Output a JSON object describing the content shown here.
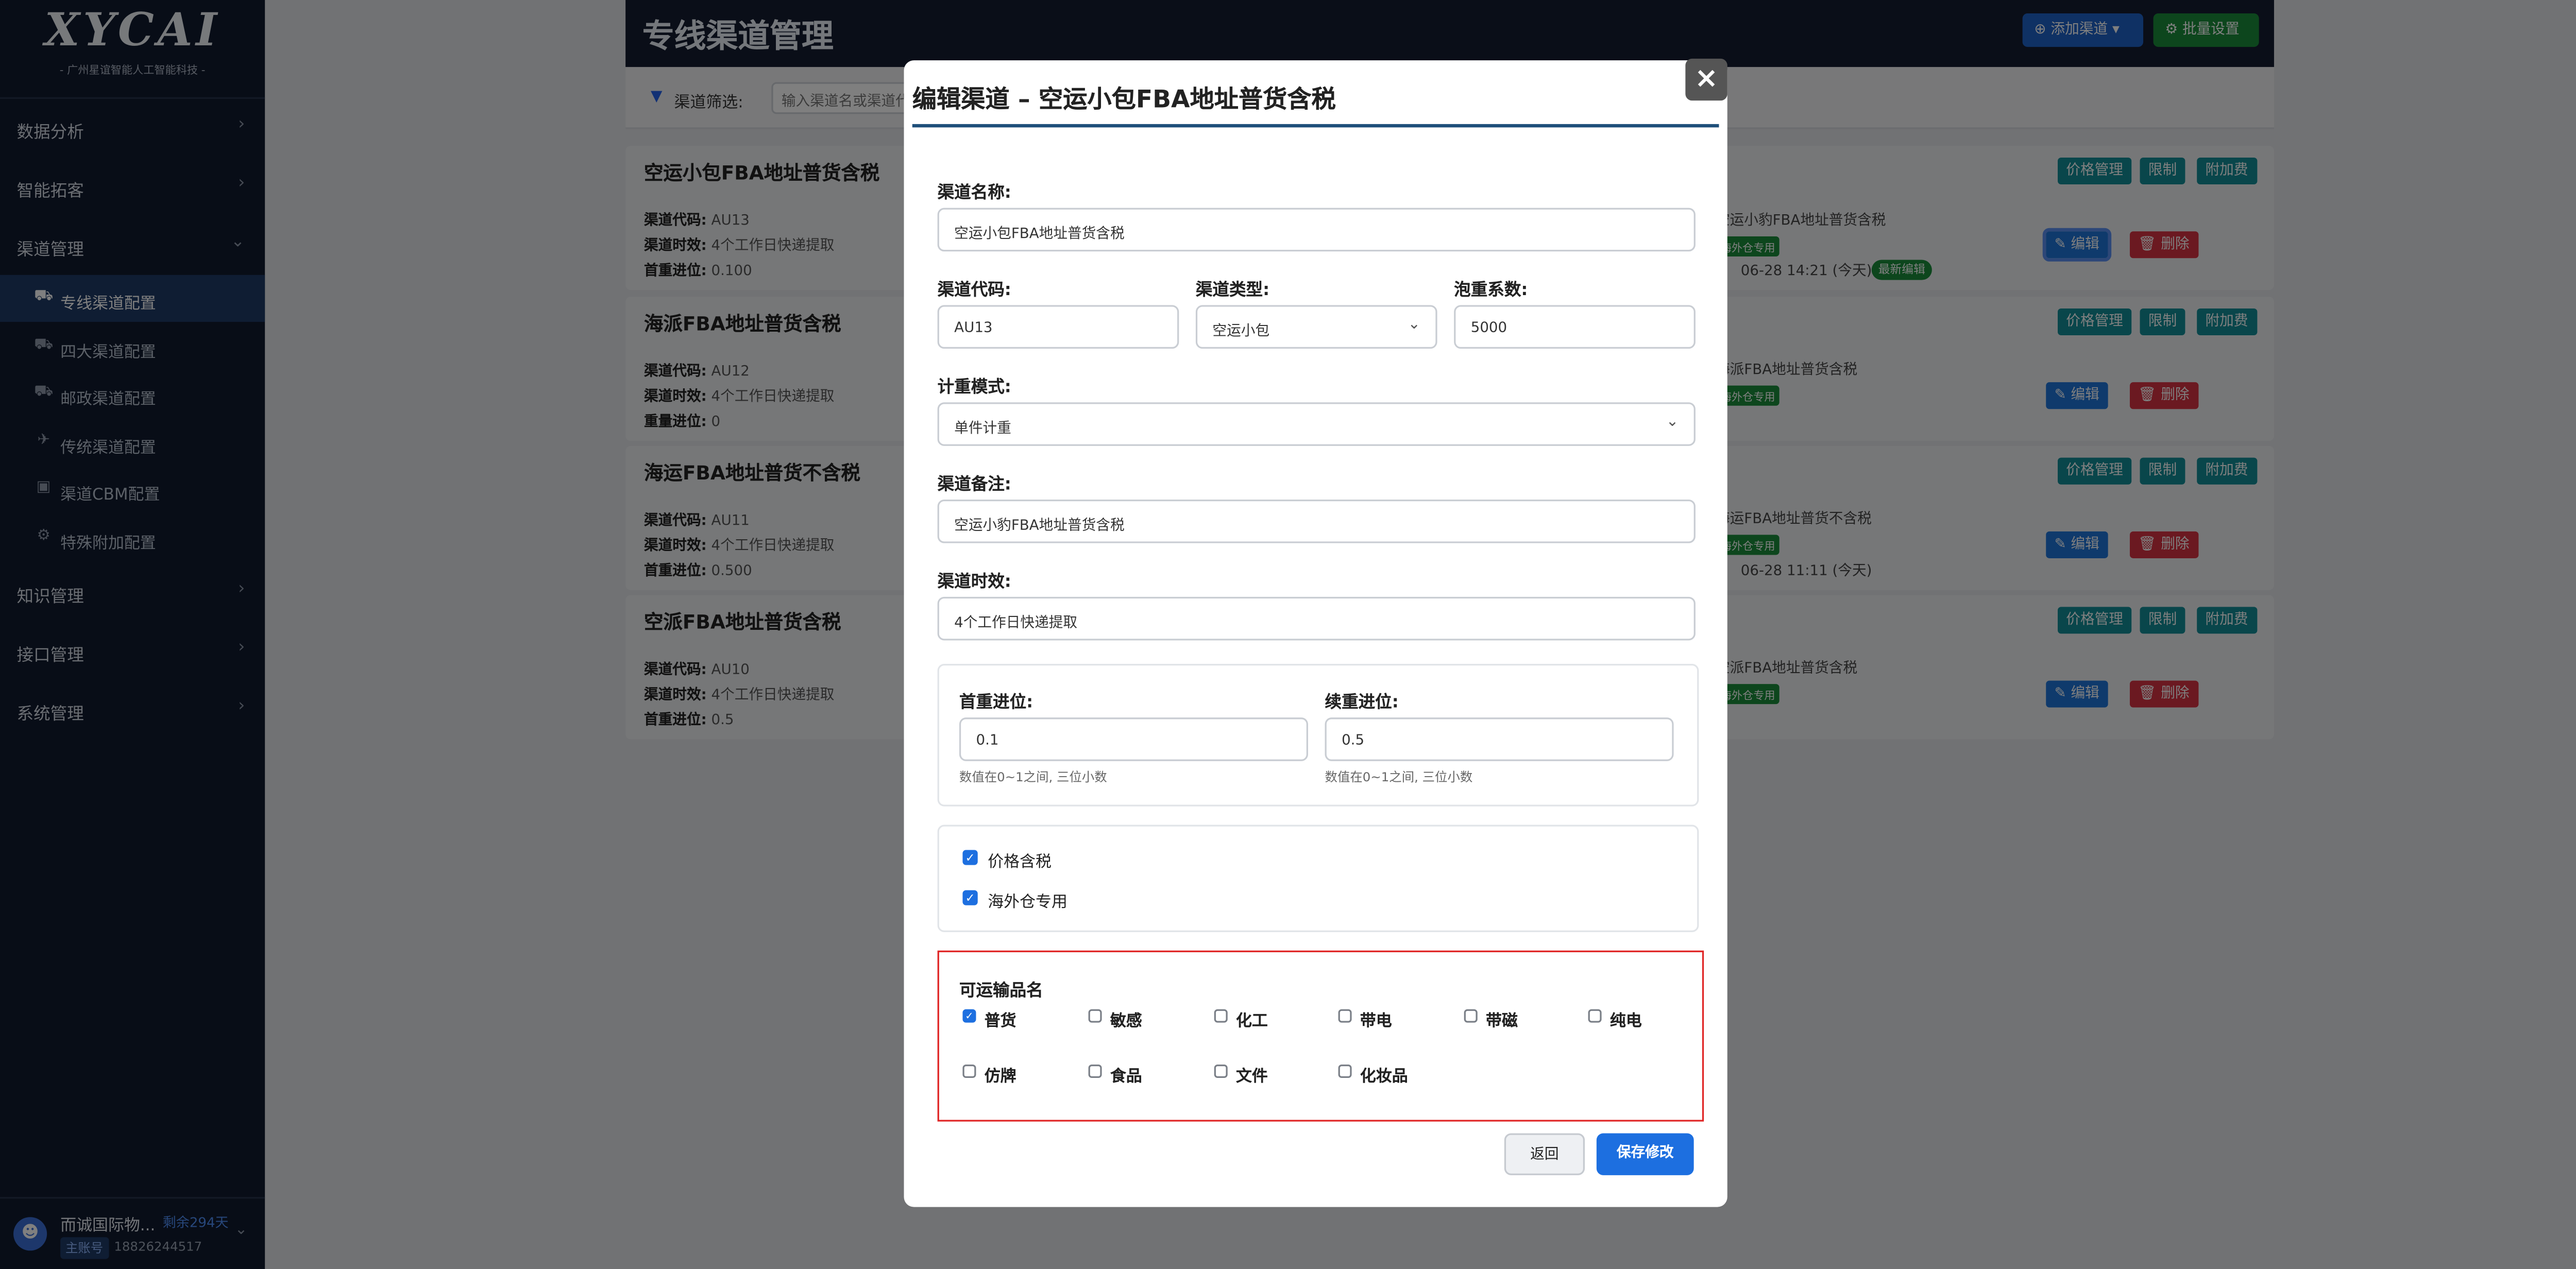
{
  "sidebar": {
    "logo": "XYCAI",
    "logo_sub": "- 广州星谊智能人工智能科技 -",
    "nav": [
      {
        "label": "数据分析",
        "chev": "›"
      },
      {
        "label": "智能拓客",
        "chev": "›"
      },
      {
        "label": "渠道管理",
        "chev": "⌄"
      },
      {
        "label": "知识管理",
        "chev": "›"
      },
      {
        "label": "接口管理",
        "chev": "›"
      },
      {
        "label": "系统管理",
        "chev": "›"
      }
    ],
    "sub": [
      {
        "label": "专线渠道配置",
        "icon": "truck-icon",
        "glyph": "⛟"
      },
      {
        "label": "四大渠道配置",
        "icon": "truck-icon",
        "glyph": "⛟"
      },
      {
        "label": "邮政渠道配置",
        "icon": "truck-icon",
        "glyph": "⛟"
      },
      {
        "label": "传统渠道配置",
        "icon": "plane-icon",
        "glyph": "✈"
      },
      {
        "label": "渠道CBM配置",
        "icon": "box-icon",
        "glyph": "▣"
      },
      {
        "label": "特殊附加配置",
        "icon": "gear-icon",
        "glyph": "⚙"
      }
    ],
    "user": {
      "name": "而诚国际物...",
      "remain": "剩余294天",
      "role": "主账号",
      "phone": "18826244517"
    }
  },
  "header": {
    "title": "专线渠道管理",
    "add_label": "添加渠道",
    "batch_label": "批量设置"
  },
  "filter": {
    "label": "渠道筛选:",
    "placeholder": "输入渠道名或渠道代码"
  },
  "cards": [
    {
      "title": "空运小包FBA地址普货含税",
      "code_label": "渠道代码:",
      "code": "AU13",
      "time_label": "渠道时效:",
      "time": "4个工作日快递提取",
      "weight_label": "首重进位:",
      "weight": "0.100",
      "note": "空运小豹FBA地址普货含税",
      "tag": "海外仓专用",
      "updated": "06-28 14:21 (今天)",
      "new_badge": "最新编辑"
    },
    {
      "title": "海派FBA地址普货含税",
      "code_label": "渠道代码:",
      "code": "AU12",
      "time_label": "渠道时效:",
      "time": "4个工作日快递提取",
      "weight_label": "重量进位:",
      "weight": "0",
      "note": "海派FBA地址普货含税",
      "tag": "海外仓专用",
      "updated": "",
      "new_badge": ""
    },
    {
      "title": "海运FBA地址普货不含税",
      "code_label": "渠道代码:",
      "code": "AU11",
      "time_label": "渠道时效:",
      "time": "4个工作日快递提取",
      "weight_label": "首重进位:",
      "weight": "0.500",
      "note": "海运FBA地址普货不含税",
      "tag": "海外仓专用",
      "updated": "06-28 11:11 (今天)",
      "new_badge": ""
    },
    {
      "title": "空派FBA地址普货含税",
      "code_label": "渠道代码:",
      "code": "AU10",
      "time_label": "渠道时效:",
      "time": "4个工作日快递提取",
      "weight_label": "首重进位:",
      "weight": "0.5",
      "note": "空派FBA地址普货含税",
      "tag": "海外仓专用",
      "updated": "",
      "new_badge": ""
    }
  ],
  "card_buttons": {
    "price": "价格管理",
    "limit": "限制",
    "surcharge": "附加费",
    "edit": "编辑",
    "delete": "删除"
  },
  "modal": {
    "title": "编辑渠道 – 空运小包FBA地址普货含税",
    "close": "×",
    "name_label": "渠道名称:",
    "name_value": "空运小包FBA地址普货含税",
    "code_label": "渠道代码:",
    "code_value": "AU13",
    "type_label": "渠道类型:",
    "type_value": "空运小包",
    "vol_label": "泡重系数:",
    "vol_value": "5000",
    "mode_label": "计重模式:",
    "mode_value": "单件计重",
    "remark_label": "渠道备注:",
    "remark_value": "空运小豹FBA地址普货含税",
    "time_label": "渠道时效:",
    "time_value": "4个工作日快递提取",
    "first_label": "首重进位:",
    "first_value": "0.1",
    "first_hint": "数值在0~1之间, 三位小数",
    "cont_label": "续重进位:",
    "cont_value": "0.5",
    "cont_hint": "数值在0~1之间, 三位小数",
    "tax_label": "价格含税",
    "tax_checked": true,
    "overseas_label": "海外仓专用",
    "overseas_checked": true,
    "goods_title": "可运输品名",
    "goods": [
      {
        "label": "普货",
        "checked": true
      },
      {
        "label": "敏感",
        "checked": false
      },
      {
        "label": "化工",
        "checked": false
      },
      {
        "label": "带电",
        "checked": false
      },
      {
        "label": "带磁",
        "checked": false
      },
      {
        "label": "纯电",
        "checked": false
      },
      {
        "label": "仿牌",
        "checked": false
      },
      {
        "label": "食品",
        "checked": false
      },
      {
        "label": "文件",
        "checked": false
      },
      {
        "label": "化妆品",
        "checked": false
      }
    ],
    "back_label": "返回",
    "save_label": "保存修改"
  },
  "colors": {
    "accent": "#1d6fe0",
    "teal": "#138d96",
    "danger": "#d63342",
    "success": "#1a8c3a",
    "sidebar": "#111a2e"
  }
}
